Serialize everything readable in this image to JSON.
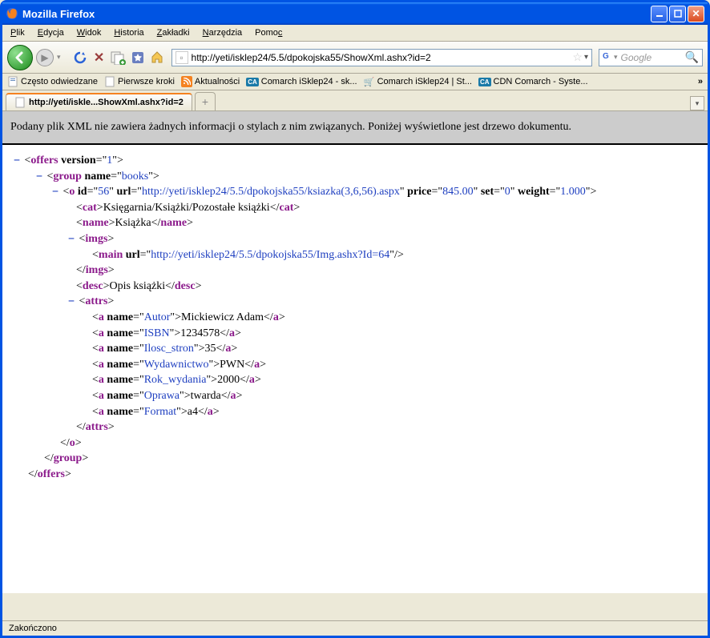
{
  "titlebar": {
    "title": "Mozilla Firefox"
  },
  "menu": {
    "plik": "Plik",
    "edycja": "Edycja",
    "widok": "Widok",
    "historia": "Historia",
    "zakladki": "Zakładki",
    "narzedzia": "Narzędzia",
    "pomoc": "Pomoc"
  },
  "url": "http://yeti/isklep24/5.5/dpokojska55/ShowXml.ashx?id=2",
  "search": {
    "placeholder": "Google"
  },
  "bookmarks": {
    "czesto": "Często odwiedzane",
    "pierwsze": "Pierwsze kroki",
    "aktualnosci": "Aktualności",
    "comarch_sk": "Comarch iSklep24 - sk...",
    "comarch_st": "Comarch iSklep24 | St...",
    "cdn": "CDN Comarch - Syste...",
    "more": "»"
  },
  "tab": {
    "title": "http://yeti/iskle...ShowXml.ashx?id=2"
  },
  "banner": "Podany plik XML nie zawiera żadnych informacji o stylach z nim związanych. Poniżej wyświetlone jest drzewo dokumentu.",
  "xml": {
    "offers": {
      "tag": "offers",
      "version_attr": "version",
      "version_val": "1"
    },
    "group": {
      "tag": "group",
      "name_attr": "name",
      "name_val": "books"
    },
    "o": {
      "tag": "o",
      "id_attr": "id",
      "id_val": "56",
      "url_attr": "url",
      "url_val": "http://yeti/isklep24/5.5/dpokojska55/ksiazka(3,6,56).aspx",
      "price_attr": "price",
      "price_val": "845.00",
      "set_attr": "set",
      "set_val": "0",
      "weight_attr": "weight",
      "weight_val": "1.000"
    },
    "cat": {
      "tag": "cat",
      "text": "Księgarnia/Książki/Pozostałe książki"
    },
    "name": {
      "tag": "name",
      "text": "Książka"
    },
    "imgs": {
      "tag": "imgs"
    },
    "main": {
      "tag": "main",
      "url_attr": "url",
      "url_val": "http://yeti/isklep24/5.5/dpokojska55/Img.ashx?Id=64"
    },
    "desc": {
      "tag": "desc",
      "text": "Opis książki"
    },
    "attrs": {
      "tag": "attrs"
    },
    "a0": {
      "tag": "a",
      "name_attr": "name",
      "name_val": "Autor",
      "text": "Mickiewicz Adam"
    },
    "a1": {
      "tag": "a",
      "name_attr": "name",
      "name_val": "ISBN",
      "text": "1234578"
    },
    "a2": {
      "tag": "a",
      "name_attr": "name",
      "name_val": "Ilosc_stron",
      "text": "35"
    },
    "a3": {
      "tag": "a",
      "name_attr": "name",
      "name_val": "Wydawnictwo",
      "text": "PWN"
    },
    "a4": {
      "tag": "a",
      "name_attr": "name",
      "name_val": "Rok_wydania",
      "text": "2000"
    },
    "a5": {
      "tag": "a",
      "name_attr": "name",
      "name_val": "Oprawa",
      "text": "twarda"
    },
    "a6": {
      "tag": "a",
      "name_attr": "name",
      "name_val": "Format",
      "text": "a4"
    }
  },
  "status": "Zakończono"
}
